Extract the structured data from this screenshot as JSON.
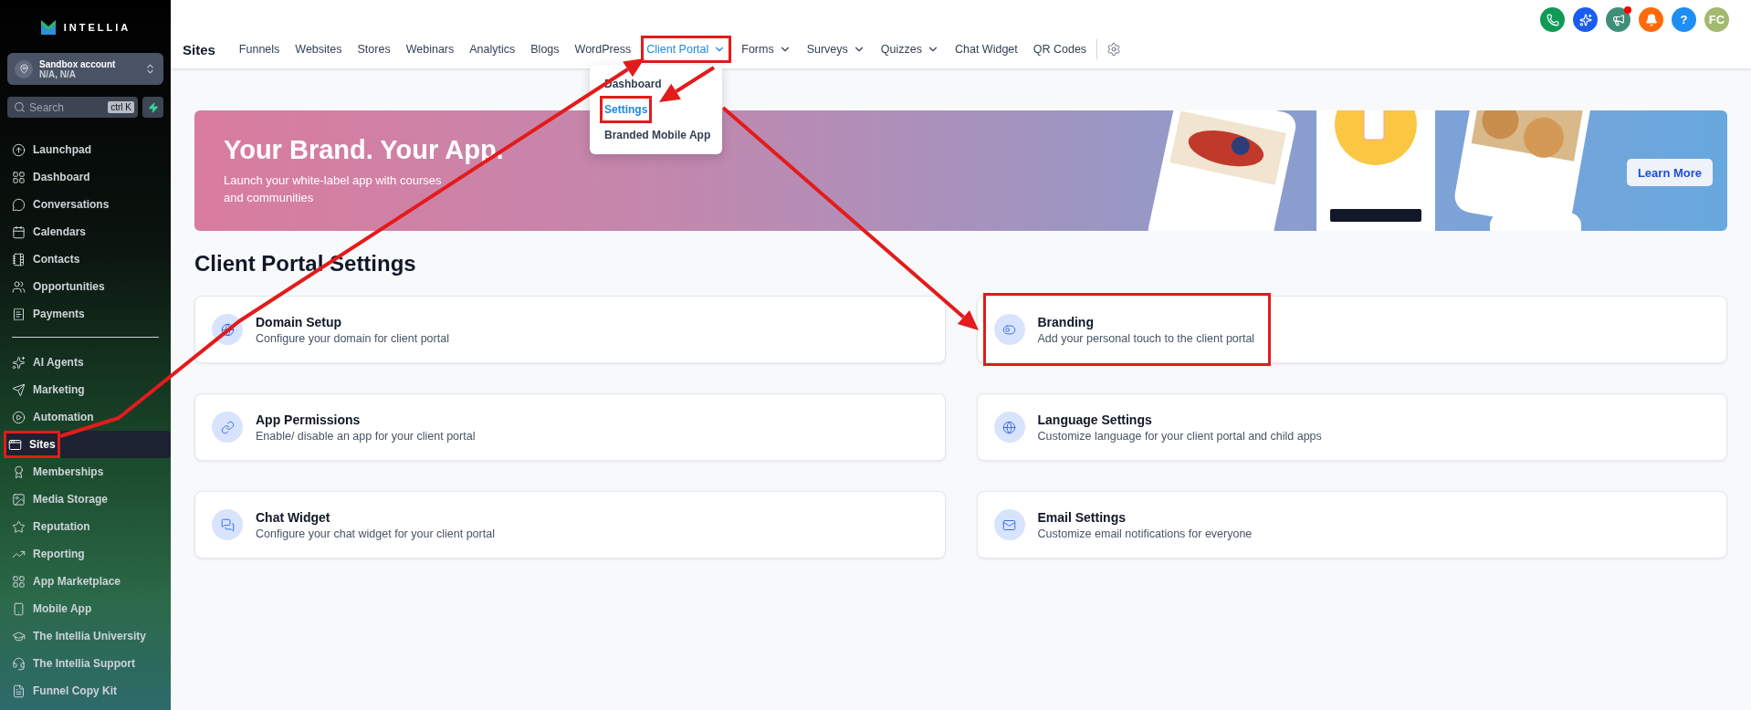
{
  "sidebar": {
    "logo": "INTELLIA",
    "account": {
      "name": "Sandbox account",
      "location": "N/A, N/A"
    },
    "search": {
      "placeholder": "Search",
      "shortcut": "ctrl K"
    },
    "groups": [
      {
        "items": [
          {
            "label": "Launchpad",
            "selected": false,
            "highlighted": false
          },
          {
            "label": "Dashboard",
            "selected": false,
            "highlighted": false
          },
          {
            "label": "Conversations",
            "selected": false,
            "highlighted": false
          },
          {
            "label": "Calendars",
            "selected": false,
            "highlighted": false
          },
          {
            "label": "Contacts",
            "selected": false,
            "highlighted": false
          },
          {
            "label": "Opportunities",
            "selected": false,
            "highlighted": false
          },
          {
            "label": "Payments",
            "selected": false,
            "highlighted": false
          }
        ]
      },
      {
        "items": [
          {
            "label": "AI Agents",
            "selected": false,
            "highlighted": false
          },
          {
            "label": "Marketing",
            "selected": false,
            "highlighted": false
          },
          {
            "label": "Automation",
            "selected": false,
            "highlighted": false
          },
          {
            "label": "Sites",
            "selected": true,
            "highlighted": true
          },
          {
            "label": "Memberships",
            "selected": false,
            "highlighted": false
          },
          {
            "label": "Media Storage",
            "selected": false,
            "highlighted": false
          },
          {
            "label": "Reputation",
            "selected": false,
            "highlighted": false
          },
          {
            "label": "Reporting",
            "selected": false,
            "highlighted": false
          },
          {
            "label": "App Marketplace",
            "selected": false,
            "highlighted": false
          },
          {
            "label": "Mobile App",
            "selected": false,
            "highlighted": false
          },
          {
            "label": "The Intellia University",
            "selected": false,
            "highlighted": false
          },
          {
            "label": "The Intellia Support",
            "selected": false,
            "highlighted": false
          },
          {
            "label": "Funnel Copy Kit",
            "selected": false,
            "highlighted": false
          }
        ]
      }
    ]
  },
  "topbar": {
    "actions": [
      {
        "kind": "phone",
        "color": "#0f9a55"
      },
      {
        "kind": "sparkle",
        "color": "#1b5cf0"
      },
      {
        "kind": "megaphone",
        "color": "#3f8f78",
        "badge": true
      },
      {
        "kind": "bell",
        "color": "#ff6a0a"
      },
      {
        "kind": "help",
        "color": "#1e8ef5",
        "label": "?"
      },
      {
        "kind": "avatar",
        "color": "#a2b96e",
        "label": "FC"
      }
    ],
    "section": "Sites",
    "tabs": [
      {
        "label": "Funnels",
        "selected": false,
        "has_menu": false,
        "highlighted": false
      },
      {
        "label": "Websites",
        "selected": false,
        "has_menu": false,
        "highlighted": false
      },
      {
        "label": "Stores",
        "selected": false,
        "has_menu": false,
        "highlighted": false
      },
      {
        "label": "Webinars",
        "selected": false,
        "has_menu": false,
        "highlighted": false
      },
      {
        "label": "Analytics",
        "selected": false,
        "has_menu": false,
        "highlighted": false
      },
      {
        "label": "Blogs",
        "selected": false,
        "has_menu": false,
        "highlighted": false
      },
      {
        "label": "WordPress",
        "selected": false,
        "has_menu": false,
        "highlighted": false
      },
      {
        "label": "Client Portal",
        "selected": true,
        "has_menu": true,
        "highlighted": true
      },
      {
        "label": "Forms",
        "selected": false,
        "has_menu": true,
        "highlighted": false
      },
      {
        "label": "Surveys",
        "selected": false,
        "has_menu": true,
        "highlighted": false
      },
      {
        "label": "Quizzes",
        "selected": false,
        "has_menu": true,
        "highlighted": false
      },
      {
        "label": "Chat Widget",
        "selected": false,
        "has_menu": false,
        "highlighted": false
      },
      {
        "label": "QR Codes",
        "selected": false,
        "has_menu": false,
        "highlighted": false
      }
    ]
  },
  "dropdown": {
    "items": [
      {
        "label": "Dashboard",
        "selected": false,
        "highlighted": false
      },
      {
        "label": "Settings",
        "selected": true,
        "highlighted": true
      },
      {
        "label": "Branded Mobile App",
        "selected": false,
        "highlighted": false
      }
    ]
  },
  "banner": {
    "title": "Your Brand. Your App.",
    "subtitle": "Launch your white-label app with courses and communities",
    "button": "Learn More"
  },
  "page_title": "Client Portal Settings",
  "cards": [
    {
      "title": "Domain Setup",
      "description": "Configure your domain for client portal",
      "highlighted": false
    },
    {
      "title": "Branding",
      "description": "Add your personal touch to the client portal",
      "highlighted": true
    },
    {
      "title": "App Permissions",
      "description": "Enable/ disable an app for your client portal",
      "highlighted": false
    },
    {
      "title": "Language Settings",
      "description": "Customize language for your client portal and child apps",
      "highlighted": false
    },
    {
      "title": "Chat Widget",
      "description": "Configure your chat widget for your client portal",
      "highlighted": false
    },
    {
      "title": "Email Settings",
      "description": "Customize email notifications for everyone",
      "highlighted": false
    }
  ]
}
